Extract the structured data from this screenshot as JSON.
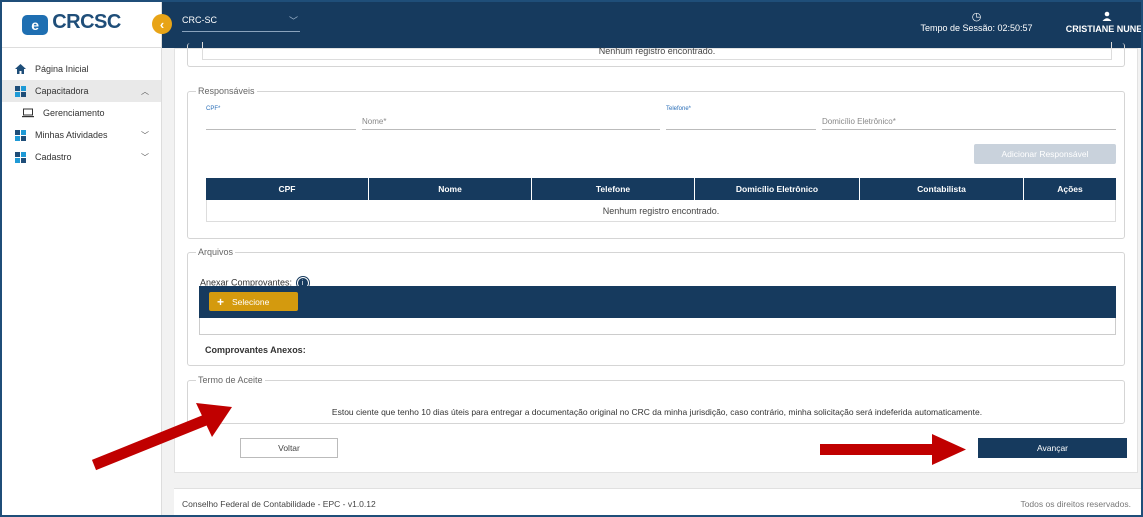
{
  "sidebar": {
    "logo_text": "CRCSC",
    "items": [
      {
        "label": "Página Inicial"
      },
      {
        "label": "Capacitadora"
      },
      {
        "label": "Gerenciamento"
      },
      {
        "label": "Minhas Atividades"
      },
      {
        "label": "Cadastro"
      }
    ]
  },
  "topbar": {
    "org": "CRC-SC",
    "session": "Tempo de Sessão: 02:50:57",
    "user": "CRISTIANE NUNES"
  },
  "top_section": {
    "empty": "Nenhum registro encontrado."
  },
  "responsaveis": {
    "legend": "Responsáveis",
    "cpf_label": "CPF*",
    "nome_placeholder": "Nome*",
    "telefone_label": "Telefone*",
    "domicilio_placeholder": "Domicílio Eletrônico*",
    "add_button": "Adicionar Responsável",
    "columns": [
      "CPF",
      "Nome",
      "Telefone",
      "Domicílio Eletrônico",
      "Contabilista",
      "Ações"
    ],
    "empty": "Nenhum registro encontrado."
  },
  "arquivos": {
    "legend": "Arquivos",
    "anexar_label": "Anexar Comprovantes:",
    "selecione": "Selecione",
    "anexos_label": "Comprovantes Anexos:"
  },
  "termo": {
    "legend": "Termo de Aceite",
    "text": "Estou ciente que tenho 10 dias úteis para entregar a documentação original no CRC da minha jurisdição, caso contrário, minha solicitação será indeferida automaticamente."
  },
  "actions": {
    "voltar": "Voltar",
    "avancar": "Avançar"
  },
  "footer": {
    "left": "Conselho Federal de Contabilidade - EPC - v1.0.12",
    "right": "Todos os direitos reservados."
  },
  "colors": {
    "navy": "#163a5e",
    "gold": "#d49a0e",
    "annotation_arrow": "#c00000"
  }
}
